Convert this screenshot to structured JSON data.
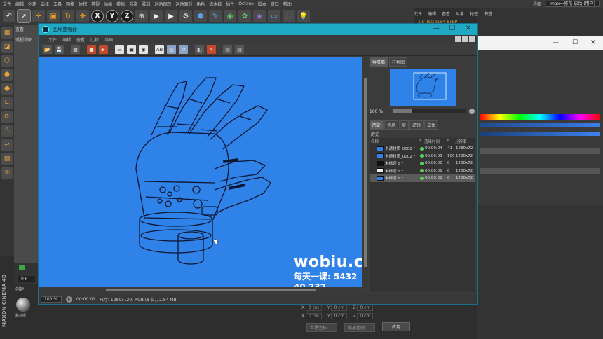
{
  "c4d": {
    "menu": [
      "文件",
      "编辑",
      "创建",
      "选择",
      "工具",
      "网格",
      "体积",
      "捕捉",
      "动画",
      "模拟",
      "渲染",
      "雕刻",
      "运动跟踪",
      "运动图形",
      "角色",
      "流水线",
      "插件",
      "Octane",
      "脚本",
      "窗口",
      "帮助"
    ],
    "layout_label": "界面",
    "layout_value": "max一修花-启动 (用户)",
    "right_menu": [
      "文件",
      "编辑",
      "查看",
      "对象",
      "标签",
      "书签"
    ],
    "object_item": "1.0 Test Jaw4 STEP",
    "viewport_menu": "查看",
    "viewport_label": "透视视图",
    "timeline_frame": "0 F",
    "material_menu": "创建",
    "material_name": "默材质",
    "brand": "MAXON CINEMA 4D",
    "coords": {
      "x1": "0 cm",
      "y1": "0 cm",
      "z1": "0 cm",
      "x2": "0 cm",
      "y2": "0 cm",
      "z2": "0 cm",
      "mode1": "世界坐标",
      "mode2": "缩放比例",
      "apply": "应用"
    }
  },
  "viewer": {
    "title": "图片查看器",
    "menu": [
      "文件",
      "编辑",
      "查看",
      "比较",
      "动画"
    ],
    "status": {
      "zoom": "100 %",
      "time": "00:00:01",
      "info": "尺寸: 1280x720, RGB (8 位), 2.84 MB"
    },
    "side": {
      "tabs": [
        "导航器",
        "柱状图"
      ],
      "nav_zoom": "100 %",
      "nav_zoom_fraction": 0.25,
      "tabs2": [
        "历史",
        "信息",
        "层",
        "滤镜",
        "立体"
      ],
      "history_label": "历史",
      "columns": {
        "name": "名称",
        "r": "R",
        "time": "渲染时间",
        "f": "F",
        "res": "分辨率"
      },
      "rows": [
        {
          "name": "卡通材质_0002 *",
          "time": "00:00:04",
          "f": "41",
          "res": "1280x72",
          "swatch": "blue",
          "sel": false
        },
        {
          "name": "卡通材质_0002 *",
          "time": "00:00:05",
          "f": "100",
          "res": "1280x72",
          "swatch": "blue",
          "sel": false
        },
        {
          "name": "未标题 5 *",
          "time": "00:00:00",
          "f": "0",
          "res": "1280x72",
          "swatch": "dark",
          "sel": false
        },
        {
          "name": "未标题 5 *",
          "time": "00:00:01",
          "f": "0",
          "res": "1280x72",
          "swatch": "white",
          "sel": false
        },
        {
          "name": "未标题 5 *",
          "time": "00:00:01",
          "f": "0",
          "res": "1280x72",
          "swatch": "blue",
          "sel": true
        }
      ]
    },
    "watermark": {
      "line1": "wobiu.com",
      "line2": "每天一课: 5432 40 232"
    }
  },
  "colors": {
    "canvas_blue": "#2f82e8",
    "titlebar": "#1fa9c4",
    "accent_orange": "#f0a020"
  }
}
